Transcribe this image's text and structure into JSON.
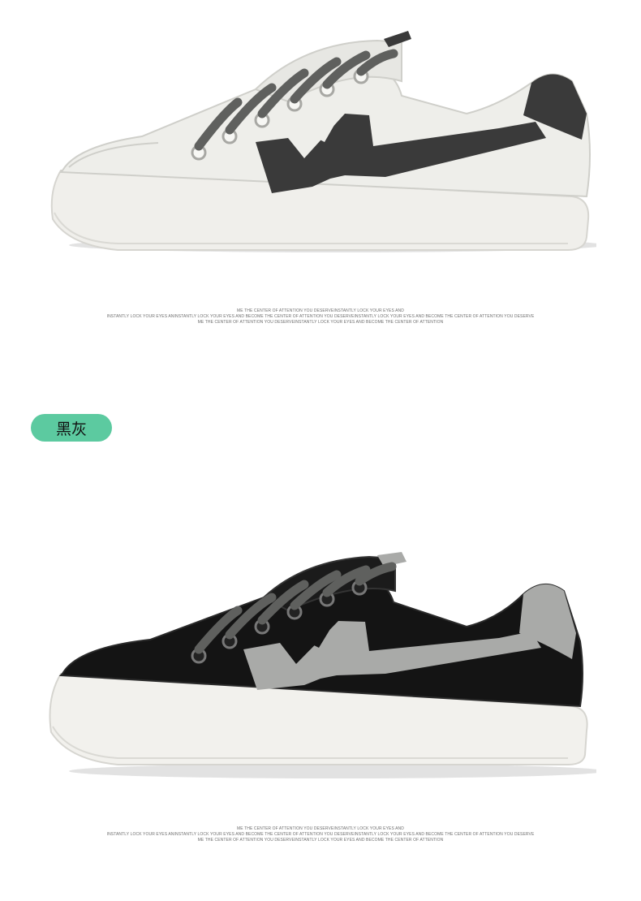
{
  "products": [
    {
      "colorway": "white-black",
      "image": "white-canvas-sneaker-image"
    },
    {
      "colorway_label": "黑灰",
      "image": "black-canvas-sneaker-image"
    }
  ],
  "captions": [
    {
      "lines": [
        "ME THE CENTER OF ATTENTION YOU DESERVEINSTANTLY LOCK YOUR EYES AND",
        "INSTANTLY LOCK YOUR EYES ANINSTANTLY LOCK YOUR EYES AND BECOME THE CENTER OF ATTENTION YOU DESERVEINSTANTLY LOCK YOUR EYES AND BECOME THE CENTER OF ATTENTION YOU DESERVE",
        "ME THE CENTER OF ATTENTION YOU DESERVEINSTANTLY LOCK YOUR EYES AND BECOME THE CENTER OF ATTENTION"
      ]
    },
    {
      "lines": [
        "ME THE CENTER OF ATTENTION YOU DESERVEINSTANTLY LOCK YOUR EYES AND",
        "INSTANTLY LOCK YOUR EYES ANINSTANTLY LOCK YOUR EYES AND BECOME THE CENTER OF ATTENTION YOU DESERVEINSTANTLY LOCK YOUR EYES AND BECOME THE CENTER OF ATTENTION YOU DESERVE",
        "ME THE CENTER OF ATTENTION YOU DESERVEINSTANTLY LOCK YOUR EYES AND BECOME THE CENTER OF ATTENTION"
      ]
    }
  ],
  "colors": {
    "badge": "#5ccaa0",
    "white_shoe_upper": "#eeeeea",
    "white_shoe_accent": "#3a3a3a",
    "black_shoe_upper": "#141414",
    "black_shoe_accent": "#a9aaa8",
    "sole": "#f1f0ec",
    "laces": "#5f605e"
  }
}
